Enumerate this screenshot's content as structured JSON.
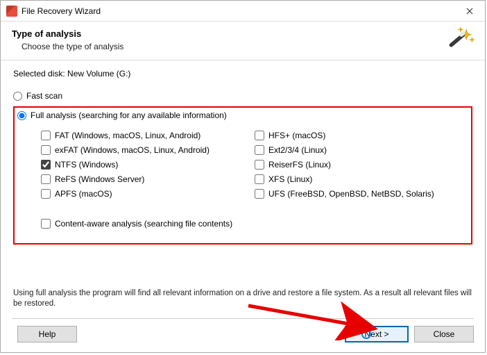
{
  "titlebar": {
    "title": "File Recovery Wizard"
  },
  "header": {
    "title": "Type of analysis",
    "subtitle": "Choose the type of analysis"
  },
  "selected_disk_label": "Selected disk: New Volume (G:)",
  "scan": {
    "fast_label": "Fast scan",
    "full_label": "Full analysis (searching for any available information)",
    "selected": "full"
  },
  "filesystems_left": [
    {
      "label": "FAT (Windows, macOS, Linux, Android)",
      "checked": false
    },
    {
      "label": "exFAT (Windows, macOS, Linux, Android)",
      "checked": false
    },
    {
      "label": "NTFS (Windows)",
      "checked": true
    },
    {
      "label": "ReFS (Windows Server)",
      "checked": false
    },
    {
      "label": "APFS (macOS)",
      "checked": false
    }
  ],
  "filesystems_right": [
    {
      "label": "HFS+ (macOS)",
      "checked": false
    },
    {
      "label": "Ext2/3/4 (Linux)",
      "checked": false
    },
    {
      "label": "ReiserFS (Linux)",
      "checked": false
    },
    {
      "label": "XFS (Linux)",
      "checked": false
    },
    {
      "label": "UFS (FreeBSD, OpenBSD, NetBSD, Solaris)",
      "checked": false
    }
  ],
  "content_aware": {
    "label": "Content-aware analysis (searching file contents)",
    "checked": false
  },
  "hint": "Using full analysis the program will find all relevant information on a drive and restore a file system. As a result all relevant files will be restored.",
  "buttons": {
    "help": "Help",
    "next": "Next >",
    "close": "Close"
  }
}
